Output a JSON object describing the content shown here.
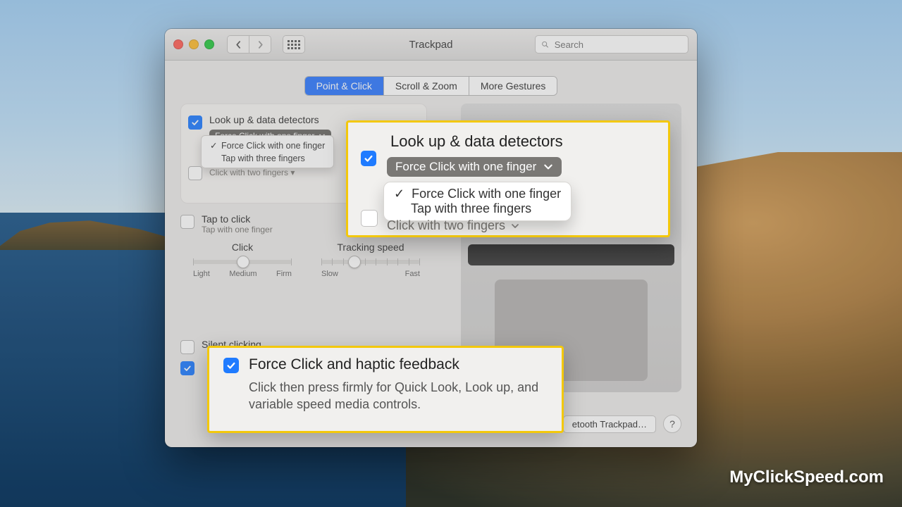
{
  "window": {
    "title": "Trackpad",
    "search_placeholder": "Search",
    "tabs": [
      "Point & Click",
      "Scroll & Zoom",
      "More Gestures"
    ],
    "active_tab_index": 0,
    "bluetooth_button": "etooth Trackpad…",
    "help_label": "?"
  },
  "settings": {
    "lookup": {
      "label": "Look up & data detectors",
      "checked": true,
      "selected": "Force Click with one finger",
      "options": [
        "Force Click with one finger",
        "Tap with three fingers"
      ]
    },
    "tap_to_click": {
      "label": "Tap to click",
      "subtitle": "Tap with one finger",
      "checked": false
    },
    "silent_clicking": {
      "label": "Silent clicking",
      "checked": false
    },
    "force_click": {
      "checked": true
    }
  },
  "sliders": {
    "click": {
      "label": "Click",
      "ticks": [
        "Light",
        "Medium",
        "Firm"
      ],
      "value_index": 1
    },
    "tracking": {
      "label": "Tracking speed",
      "ticks_left": "Slow",
      "ticks_right": "Fast",
      "segments": 10,
      "value_index": 3
    }
  },
  "callout_lookup": {
    "title": "Look up & data detectors",
    "pill": "Force Click with one finger",
    "menu": [
      "Force Click with one finger",
      "Tap with three fingers"
    ],
    "partial_below": "Click with two fingers"
  },
  "callout_force": {
    "title": "Force Click and haptic feedback",
    "desc": "Click then press firmly for Quick Look, Look up, and variable speed media controls."
  },
  "watermark": "MyClickSpeed.com"
}
